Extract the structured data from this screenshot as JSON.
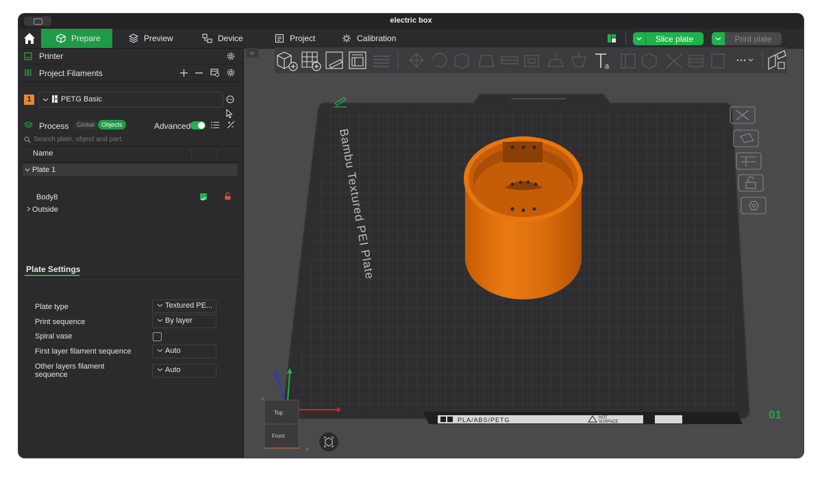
{
  "window": {
    "title": "electric box"
  },
  "tabs": [
    {
      "label": "Prepare",
      "icon": "cube-icon"
    },
    {
      "label": "Preview",
      "icon": "layers-icon"
    },
    {
      "label": "Device",
      "icon": "device-icon"
    },
    {
      "label": "Project",
      "icon": "document-icon"
    },
    {
      "label": "Calibration",
      "icon": "calibration-icon"
    }
  ],
  "actions": {
    "slice_label": "Slice plate",
    "print_label": "Print plate"
  },
  "left": {
    "printer_label": "Printer",
    "filaments_label": "Project Filaments",
    "filament": {
      "index": "1",
      "name": "PETG Basic"
    },
    "process_label": "Process",
    "process_global": "Global",
    "process_objects": "Objects",
    "advanced_label": "Advanced",
    "advanced_on": true,
    "search_placeholder": "Search plate, object and part.",
    "name_header": "Name",
    "tree": {
      "plate": "Plate 1",
      "body": "Body8",
      "outside": "Outside"
    }
  },
  "plate_settings": {
    "title": "Plate Settings",
    "rows": [
      {
        "label": "Plate type",
        "value": "Textured PE..."
      },
      {
        "label": "Print sequence",
        "value": "By layer"
      },
      {
        "label": "Spiral vase",
        "checked": false
      },
      {
        "label": "First layer filament sequence",
        "value": "Auto"
      },
      {
        "label_line1": "Other layers filament",
        "label_line2": "sequence",
        "value": "Auto"
      }
    ]
  },
  "viewport": {
    "plate_name": "Bambu Textured PEI Plate",
    "plate_number": "01",
    "plate_footer": "PLA/ABS/PETG",
    "hot_line1": "HOT",
    "hot_line2": "SURFACE",
    "cube_top": "Top",
    "cube_front": "Front",
    "axis_x": "x",
    "axis_z": "z"
  },
  "colors": {
    "accent": "#1fb14b",
    "model": "#e8760f",
    "filament_badge": "#e88a2a"
  }
}
